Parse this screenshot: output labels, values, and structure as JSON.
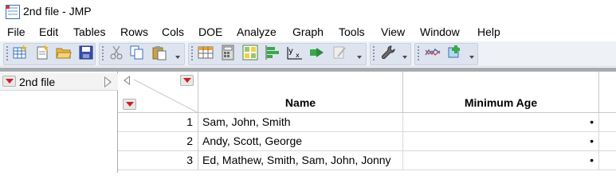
{
  "window": {
    "title": "2nd file - JMP",
    "app_icon": "jmp-data-table-icon"
  },
  "menu": {
    "items": [
      "File",
      "Edit",
      "Tables",
      "Rows",
      "Cols",
      "DOE",
      "Analyze",
      "Graph",
      "Tools",
      "View",
      "Window",
      "Help"
    ]
  },
  "toolbar": {
    "groups": [
      {
        "icons": [
          "new-data-table-icon",
          "new-script-icon",
          "open-folder-icon",
          "save-icon"
        ]
      },
      {
        "icons": [
          "cut-icon",
          "copy-icon",
          "paste-icon"
        ]
      },
      {
        "icons": [
          "data-grid-icon",
          "calculator-icon",
          "layout-icon",
          "distribution-icon",
          "fit-y-by-x-icon",
          "arrow-icon",
          "pen-icon"
        ]
      },
      {
        "icons": [
          "wrench-icon"
        ]
      },
      {
        "icons": [
          "graph-builder-icon",
          "add-on-icon"
        ]
      }
    ]
  },
  "left_panel": {
    "table_name": "2nd file"
  },
  "table": {
    "columns": [
      "Name",
      "Minimum Age"
    ],
    "rows": [
      {
        "num": "1",
        "name": "Sam, John, Smith",
        "min_age": "•"
      },
      {
        "num": "2",
        "name": "Andy, Scott, George",
        "min_age": "•"
      },
      {
        "num": "3",
        "name": "Ed, Mathew, Smith, Sam, John, Jonny",
        "min_age": "•"
      }
    ]
  },
  "colors": {
    "red_triangle": "#cc1f1f",
    "toolbar_bg": "#dde4ef",
    "splitter": "#a9abb0"
  }
}
